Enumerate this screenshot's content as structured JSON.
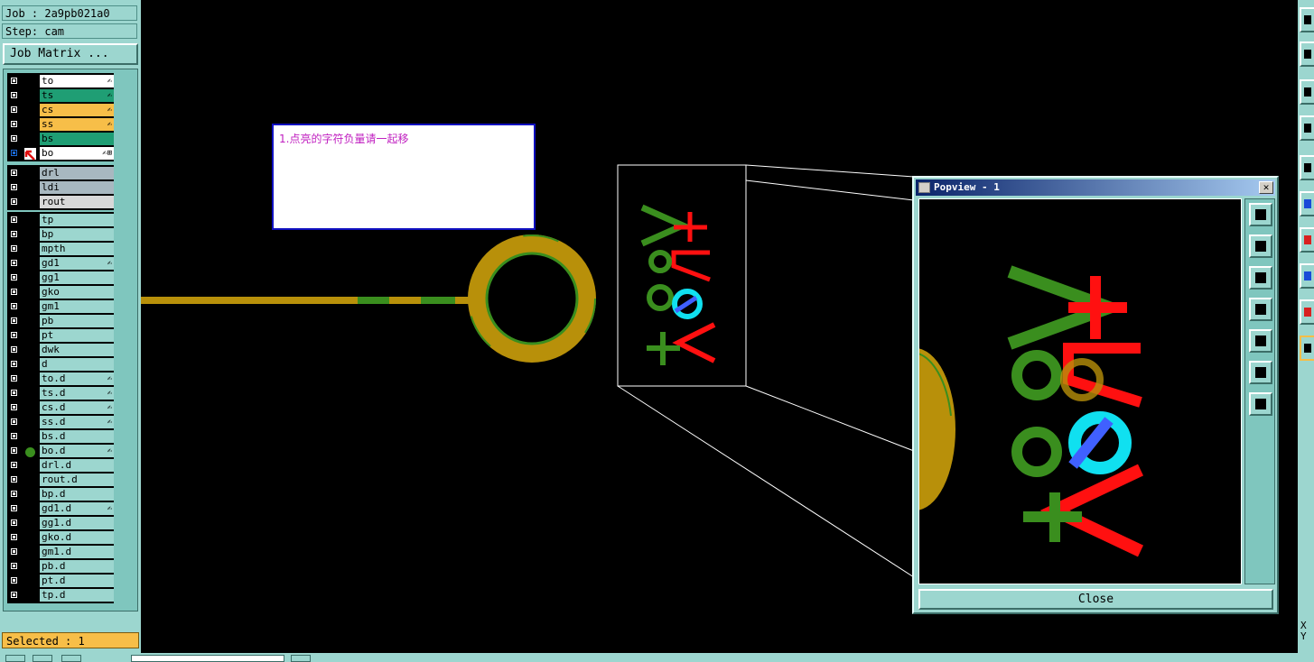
{
  "header": {
    "job": "Job : 2a9pb021a0",
    "step": "Step: cam",
    "job_matrix_label": "Job Matrix ..."
  },
  "layers": {
    "group1": [
      {
        "name": "to",
        "color": "#ffffff",
        "flag": "✍"
      },
      {
        "name": "ts",
        "color": "#1f9e74",
        "flag": "✍"
      },
      {
        "name": "cs",
        "color": "#f7be48",
        "flag": "✍"
      },
      {
        "name": "ss",
        "color": "#f7be48",
        "flag": "✍"
      },
      {
        "name": "bs",
        "color": "#1f9e74",
        "flag": ""
      },
      {
        "name": "bo",
        "color": "#ffffff",
        "flag": "✍⊞",
        "active": true
      }
    ],
    "group2": [
      {
        "name": "drl",
        "color": "#a8b8c0",
        "flag": ""
      },
      {
        "name": "ldi",
        "color": "#a8b8c0",
        "flag": ""
      },
      {
        "name": "rout",
        "color": "#d8d8d8",
        "flag": ""
      }
    ],
    "group3": [
      {
        "name": "tp",
        "flag": ""
      },
      {
        "name": "bp",
        "flag": ""
      },
      {
        "name": "mpth",
        "flag": ""
      },
      {
        "name": "gd1",
        "flag": "✍"
      },
      {
        "name": "gg1",
        "flag": ""
      },
      {
        "name": "gko",
        "flag": ""
      },
      {
        "name": "gm1",
        "flag": ""
      },
      {
        "name": "pb",
        "flag": ""
      },
      {
        "name": "pt",
        "flag": ""
      },
      {
        "name": "dwk",
        "flag": ""
      },
      {
        "name": "d",
        "flag": ""
      },
      {
        "name": "to.d",
        "flag": "✍"
      },
      {
        "name": "ts.d",
        "flag": "✍"
      },
      {
        "name": "cs.d",
        "flag": "✍"
      },
      {
        "name": "ss.d",
        "flag": "✍"
      },
      {
        "name": "bs.d",
        "flag": ""
      },
      {
        "name": "bo.d",
        "flag": "✍",
        "dot": true
      },
      {
        "name": "drl.d",
        "flag": ""
      },
      {
        "name": "rout.d",
        "flag": ""
      },
      {
        "name": "bp.d",
        "flag": ""
      },
      {
        "name": "gd1.d",
        "flag": "✍"
      },
      {
        "name": "gg1.d",
        "flag": ""
      },
      {
        "name": "gko.d",
        "flag": ""
      },
      {
        "name": "gm1.d",
        "flag": ""
      },
      {
        "name": "pb.d",
        "flag": ""
      },
      {
        "name": "pt.d",
        "flag": ""
      },
      {
        "name": "tp.d",
        "flag": ""
      }
    ]
  },
  "status": {
    "selected": "Selected : 1"
  },
  "note": {
    "text": "1.点亮的字符负量请一起移"
  },
  "popview": {
    "title": "Popview - 1",
    "close_label": "Close",
    "close_x": "✕"
  },
  "coords": {
    "xy": "X Y"
  },
  "colors": {
    "panel": "#9cd6cf",
    "pad_gold": "#b8900a",
    "trace_green": "#3a8e1e",
    "silk_red": "#ff1010",
    "silk_cyan": "#10e0f0",
    "silk_blue": "#4060ff"
  }
}
